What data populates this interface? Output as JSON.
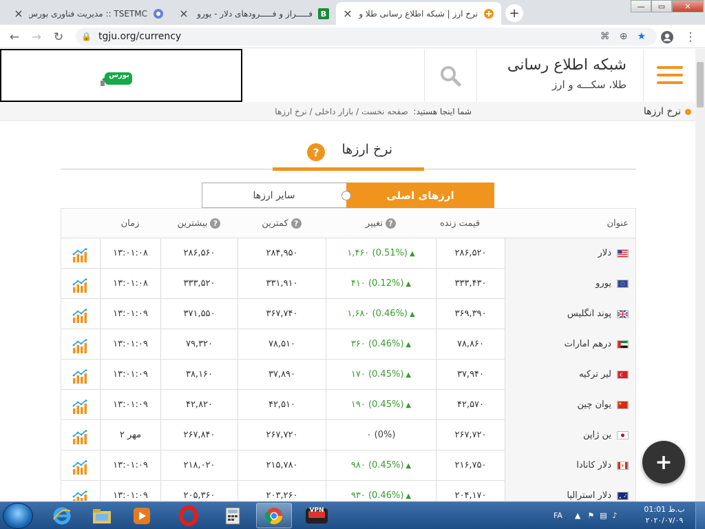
{
  "browser": {
    "tabs": [
      {
        "title": "نرخ ارز | شبکه اطلاع رسانی طلا و ارز",
        "active": true
      },
      {
        "title": "فـــــراز و فـــــرودهای دلار - یورو - طلا",
        "active": false
      },
      {
        "title": "TSETMC :: مدیریت فناوری بورس تهران",
        "active": false
      }
    ],
    "new_tab": "+",
    "close_glyph": "×",
    "url": "tgju.org/currency",
    "window": {
      "min": "—",
      "max": "▭",
      "close": "✕"
    }
  },
  "site": {
    "brand_title": "شبکه اطلاع رسانی",
    "brand_subtitle": "طلا، سکـــه و ارز",
    "ad_label": "بورس",
    "page_label": "نرخ ارزها",
    "breadcrumb": {
      "prefix": "شما اینجا هستید:",
      "items": [
        "صفحه نخست",
        "بازار داخلی",
        "نرخ ارزها"
      ],
      "sep": "/"
    },
    "section_title": "نرخ ارزها",
    "help": "?",
    "segments": {
      "main": "ارزهای اصلی",
      "other": "سایر ارزها"
    },
    "fab": "+"
  },
  "table": {
    "headers": {
      "title": "عنوان",
      "live": "قیمت زنده",
      "change": "تغییر",
      "low": "کمترین",
      "high": "بیشترین",
      "time": "زمان"
    },
    "rows": [
      {
        "name": "دلار",
        "flag": "us",
        "live": "۲۸۶,۵۲۰",
        "change": "۱,۴۶۰ (0.51%)",
        "up": true,
        "low": "۲۸۴,۹۵۰",
        "high": "۲۸۶,۵۶۰",
        "time": "۱۳:۰۱:۰۸"
      },
      {
        "name": "یورو",
        "flag": "eu",
        "live": "۳۳۳,۴۳۰",
        "change": "۴۱۰ (0.12%)",
        "up": true,
        "low": "۳۳۱,۹۱۰",
        "high": "۳۳۳,۵۲۰",
        "time": "۱۳:۰۱:۰۸"
      },
      {
        "name": "پوند انگلیس",
        "flag": "gb",
        "live": "۳۶۹,۳۹۰",
        "change": "۱,۶۸۰ (0.46%)",
        "up": true,
        "low": "۳۶۷,۷۴۰",
        "high": "۳۷۱,۵۵۰",
        "time": "۱۳:۰۱:۰۹"
      },
      {
        "name": "درهم امارات",
        "flag": "ae",
        "live": "۷۸,۸۶۰",
        "change": "۳۶۰ (0.46%)",
        "up": true,
        "low": "۷۸,۵۱۰",
        "high": "۷۹,۳۲۰",
        "time": "۱۳:۰۱:۰۹"
      },
      {
        "name": "لیر ترکیه",
        "flag": "tr",
        "live": "۳۷,۹۴۰",
        "change": "۱۷۰ (0.45%)",
        "up": true,
        "low": "۳۷,۸۹۰",
        "high": "۳۸,۱۶۰",
        "time": "۱۳:۰۱:۰۹"
      },
      {
        "name": "یوان چین",
        "flag": "cn",
        "live": "۴۲,۵۷۰",
        "change": "۱۹۰ (0.45%)",
        "up": true,
        "low": "۴۲,۵۱۰",
        "high": "۴۲,۸۲۰",
        "time": "۱۳:۰۱:۰۹"
      },
      {
        "name": "ین ژاپن",
        "flag": "jp",
        "live": "۲۶۷,۷۲۰",
        "change": "۰ (0%)",
        "up": false,
        "low": "۲۶۷,۷۲۰",
        "high": "۲۶۷,۸۴۰",
        "time": "۲ مهر"
      },
      {
        "name": "دلار کانادا",
        "flag": "ca",
        "live": "۲۱۶,۷۵۰",
        "change": "۹۸۰ (0.45%)",
        "up": true,
        "low": "۲۱۵,۷۸۰",
        "high": "۲۱۸,۰۲۰",
        "time": "۱۳:۰۱:۰۹"
      },
      {
        "name": "دلار استرالیا",
        "flag": "au",
        "live": "۲۰۴,۱۷۰",
        "change": "۹۳۰ (0.46%)",
        "up": true,
        "low": "۲۰۳,۲۶۰",
        "high": "۲۰۵,۳۶۰",
        "time": "۱۳:۰۱:۰۹"
      }
    ]
  },
  "taskbar": {
    "lang": "FA",
    "vpn": "VPN",
    "time": "01:01 ب.ظ",
    "date": "۲۰۲۰/۰۷/۰۹"
  },
  "colors": {
    "accent": "#f0941d",
    "positive": "#3a9a2f"
  }
}
